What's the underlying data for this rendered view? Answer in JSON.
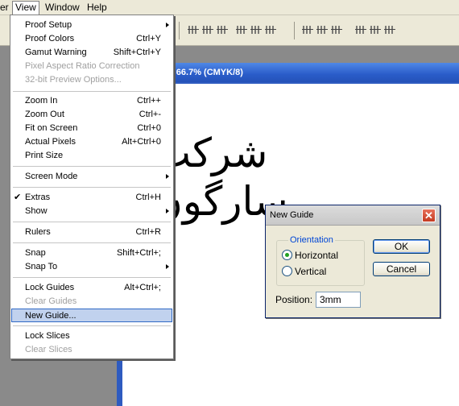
{
  "menubar": {
    "partial_item": "er",
    "view": "View",
    "window": "Window",
    "help": "Help"
  },
  "document": {
    "title": "@ 66.7% (CMYK/8)",
    "artwork_text": "شرکت سارگون"
  },
  "view_menu": {
    "proof_setup": "Proof Setup",
    "proof_colors": "Proof Colors",
    "proof_colors_sc": "Ctrl+Y",
    "gamut_warning": "Gamut Warning",
    "gamut_warning_sc": "Shift+Ctrl+Y",
    "pixel_aspect": "Pixel Aspect Ratio Correction",
    "preview_32bit": "32-bit Preview Options...",
    "zoom_in": "Zoom In",
    "zoom_in_sc": "Ctrl++",
    "zoom_out": "Zoom Out",
    "zoom_out_sc": "Ctrl+-",
    "fit_on_screen": "Fit on Screen",
    "fit_on_screen_sc": "Ctrl+0",
    "actual_pixels": "Actual Pixels",
    "actual_pixels_sc": "Alt+Ctrl+0",
    "print_size": "Print Size",
    "screen_mode": "Screen Mode",
    "extras": "Extras",
    "extras_sc": "Ctrl+H",
    "show": "Show",
    "rulers": "Rulers",
    "rulers_sc": "Ctrl+R",
    "snap": "Snap",
    "snap_sc": "Shift+Ctrl+;",
    "snap_to": "Snap To",
    "lock_guides": "Lock Guides",
    "lock_guides_sc": "Alt+Ctrl+;",
    "clear_guides": "Clear Guides",
    "new_guide": "New Guide...",
    "lock_slices": "Lock Slices",
    "clear_slices": "Clear Slices"
  },
  "dialog": {
    "title": "New Guide",
    "orientation_legend": "Orientation",
    "horizontal": "Horizontal",
    "vertical": "Vertical",
    "selected_orientation": "Horizontal",
    "ok": "OK",
    "cancel": "Cancel",
    "position_label": "Position:",
    "position_value": "3mm"
  },
  "colors": {
    "title_bar_blue": "#2a5cc9",
    "menu_highlight": "#c1d2ee",
    "dialog_bg": "#ece9d8",
    "close_red": "#c43b22"
  }
}
